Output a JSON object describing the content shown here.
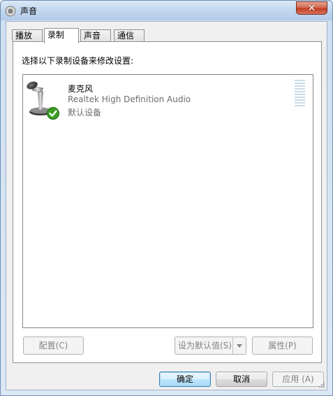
{
  "window": {
    "title": "声音",
    "close_glyph": "✕"
  },
  "tabs": [
    {
      "label": "播放"
    },
    {
      "label": "录制"
    },
    {
      "label": "声音"
    },
    {
      "label": "通信"
    }
  ],
  "active_tab": 1,
  "recording": {
    "instruction": "选择以下录制设备来修改设置:",
    "devices": [
      {
        "name": "麦克风",
        "driver": "Realtek High Definition Audio",
        "status": "默认设备",
        "icon": "microphone-icon",
        "badge": "check-icon",
        "level": 0
      }
    ]
  },
  "panel_buttons": {
    "configure": "配置(C)",
    "set_default": "设为默认值(S)",
    "properties": "属性(P)"
  },
  "dialog_buttons": {
    "ok": "确定",
    "cancel": "取消",
    "apply": "应用 (A)"
  },
  "colors": {
    "title_bg": "#c2d7ef",
    "close": "#c23e22",
    "check": "#3a9d23",
    "meter": "#c7dbe7"
  }
}
